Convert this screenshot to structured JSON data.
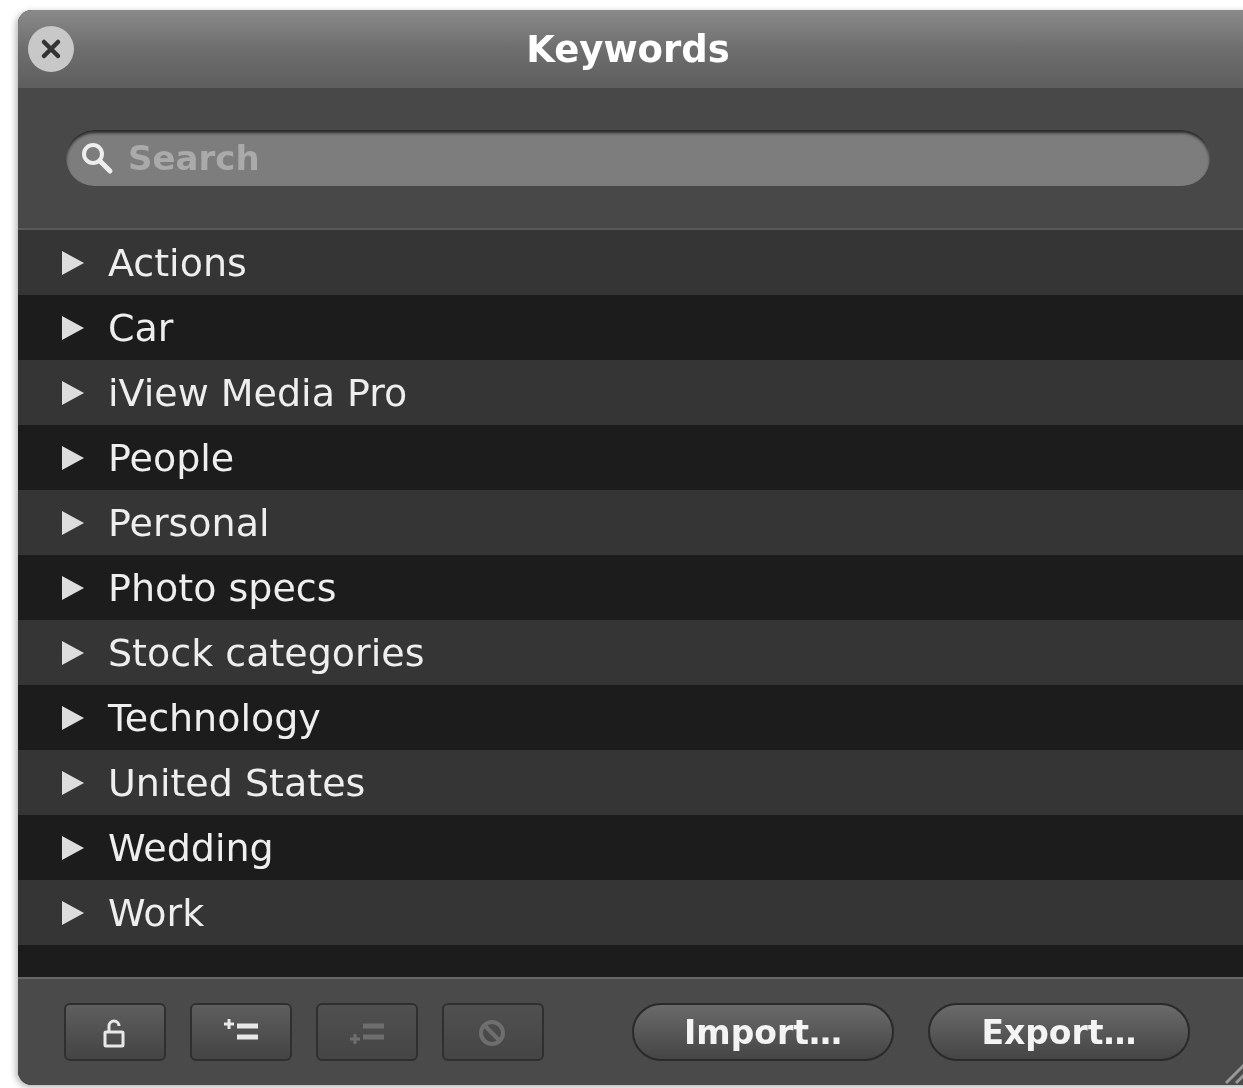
{
  "window": {
    "title": "Keywords"
  },
  "search": {
    "placeholder": "Search"
  },
  "keywords": [
    {
      "label": "Actions",
      "expanded": false
    },
    {
      "label": "Car",
      "expanded": false
    },
    {
      "label": "iView Media Pro",
      "expanded": false
    },
    {
      "label": "People",
      "expanded": false
    },
    {
      "label": "Personal",
      "expanded": false
    },
    {
      "label": "Photo specs",
      "expanded": false
    },
    {
      "label": "Stock categories",
      "expanded": false
    },
    {
      "label": "Technology",
      "expanded": false
    },
    {
      "label": "United States",
      "expanded": false
    },
    {
      "label": "Wedding",
      "expanded": false
    },
    {
      "label": "Work",
      "expanded": false
    }
  ],
  "tool_buttons": [
    {
      "kind": "lock",
      "disabled": false
    },
    {
      "kind": "add",
      "disabled": false
    },
    {
      "kind": "addsub",
      "disabled": true
    },
    {
      "kind": "remove",
      "disabled": true
    }
  ],
  "buttons": [
    "Import…",
    "Export…"
  ]
}
